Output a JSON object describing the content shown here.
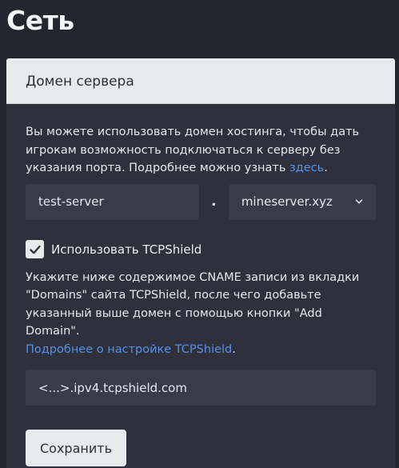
{
  "page": {
    "title": "Сеть"
  },
  "card": {
    "header": "Домен сервера",
    "description_text": "Вы можете использовать домен хостинга, чтобы дать игрокам возможность подключаться к серверу без указания порта. Подробнее можно узнать ",
    "description_link": "здесь",
    "description_end": ".",
    "subdomain_value": "test-server",
    "separator": ".",
    "domain_selected": "mineserver.xyz",
    "tcpshield_checked": true,
    "tcpshield_label": "Использовать TCPShield",
    "tcpshield_desc": "Укажите ниже содержимое CNAME записи из вкладки \"Domains\" сайта TCPShield, после чего добавьте указанный выше домен с помощью кнопки \"Add Domain\".",
    "tcpshield_link": "Подробнее о настройке TCPShield",
    "tcpshield_link_end": ".",
    "cname_value": "<...>.ipv4.tcpshield.com",
    "save_label": "Сохранить"
  },
  "icons": {
    "checkbox": "check-icon",
    "select": "chevron-down-icon"
  },
  "colors": {
    "background": "#23252f",
    "card": "#2e313c",
    "link": "#5b8ee6",
    "input": "#393c48"
  }
}
